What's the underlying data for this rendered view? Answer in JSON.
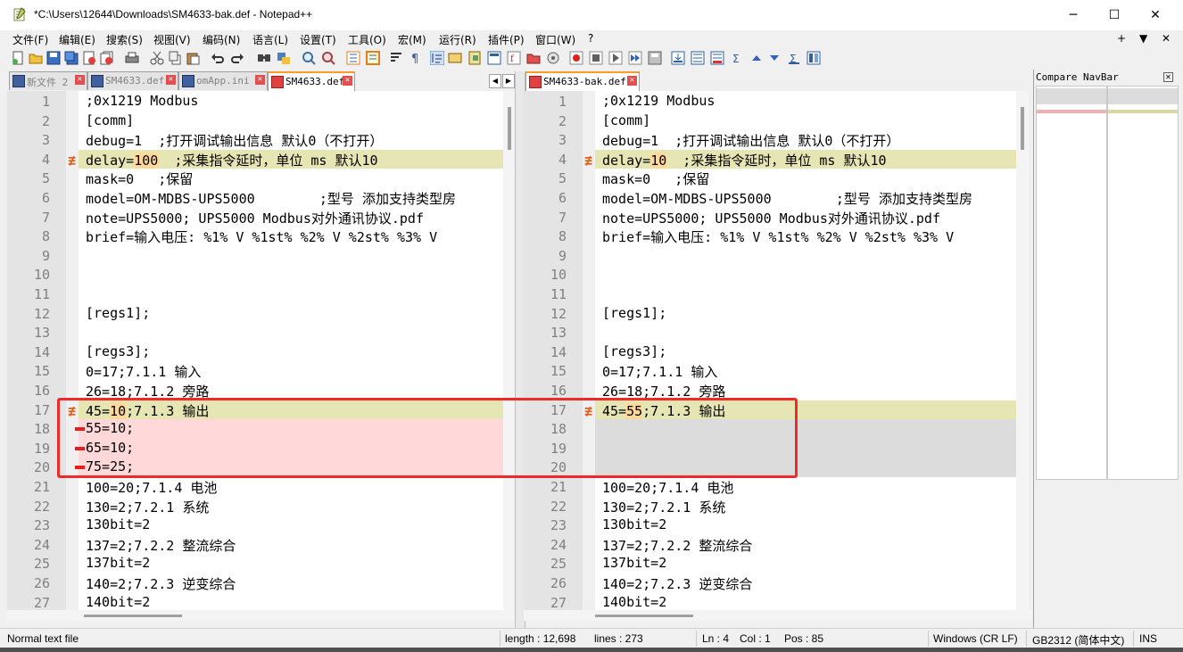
{
  "window": {
    "title": "*C:\\Users\\12644\\Downloads\\SM4633-bak.def - Notepad++",
    "minimize_glyph": "─",
    "maximize_glyph": "☐",
    "close_glyph": "✕"
  },
  "menu": {
    "items": [
      "文件(F)",
      "编辑(E)",
      "搜索(S)",
      "视图(V)",
      "编码(N)",
      "语言(L)",
      "设置(T)",
      "工具(O)",
      "宏(M)",
      "运行(R)",
      "插件(P)",
      "窗口(W)",
      "?"
    ],
    "right": [
      "+",
      "▼",
      "✕"
    ]
  },
  "left_tabs": [
    {
      "label": "新文件 2"
    },
    {
      "label": "SM4633.def"
    },
    {
      "label": "omApp.ini"
    },
    {
      "label": "SM4633.def"
    }
  ],
  "right_tabs": [
    {
      "label": "SM4633-bak.def"
    }
  ],
  "tab_nav": {
    "prev": "◀",
    "next": "▶"
  },
  "left_pane": {
    "lines": [
      {
        "n": "1",
        "text": ";0x1219 Modbus",
        "state": ""
      },
      {
        "n": "2",
        "text": "[comm]",
        "state": ""
      },
      {
        "n": "3",
        "text": "debug=1  ;打开调试输出信息 默认0（不打开）",
        "state": ""
      },
      {
        "n": "4",
        "pre": "delay=",
        "hl": "100",
        "post": "  ;采集指令延时，单位 ms 默认10",
        "state": "changed"
      },
      {
        "n": "5",
        "text": "mask=0   ;保留",
        "state": ""
      },
      {
        "n": "6",
        "text": "model=OM-MDBS-UPS5000        ;型号 添加支持类型房",
        "state": ""
      },
      {
        "n": "7",
        "text": "note=UPS5000; UPS5000 Modbus对外通讯协议.pdf",
        "state": ""
      },
      {
        "n": "8",
        "text": "brief=输入电压: %1% V %1st% %2% V %2st% %3% V",
        "state": ""
      },
      {
        "n": "9",
        "text": "",
        "state": ""
      },
      {
        "n": "10",
        "text": "",
        "state": ""
      },
      {
        "n": "11",
        "text": "",
        "state": ""
      },
      {
        "n": "12",
        "text": "[regs1];",
        "state": ""
      },
      {
        "n": "13",
        "text": "",
        "state": ""
      },
      {
        "n": "14",
        "text": "[regs3];",
        "state": ""
      },
      {
        "n": "15",
        "text": "0=17;7.1.1 输入",
        "state": ""
      },
      {
        "n": "16",
        "text": "26=18;7.1.2 旁路",
        "state": ""
      },
      {
        "n": "17",
        "pre": "45=",
        "hl": "10",
        "post": ";7.1.3 输出",
        "state": "changed"
      },
      {
        "n": "18",
        "text": "55=10;",
        "state": "removed"
      },
      {
        "n": "19",
        "text": "65=10;",
        "state": "removed"
      },
      {
        "n": "20",
        "text": "75=25;",
        "state": "removed"
      },
      {
        "n": "21",
        "text": "100=20;7.1.4 电池",
        "state": ""
      },
      {
        "n": "22",
        "text": "130=2;7.2.1 系统",
        "state": ""
      },
      {
        "n": "23",
        "text": "130bit=2",
        "state": ""
      },
      {
        "n": "24",
        "text": "137=2;7.2.2 整流综合",
        "state": ""
      },
      {
        "n": "25",
        "text": "137bit=2",
        "state": ""
      },
      {
        "n": "26",
        "text": "140=2;7.2.3 逆变综合",
        "state": ""
      },
      {
        "n": "27",
        "text": "140bit=2",
        "state": ""
      }
    ]
  },
  "right_pane": {
    "lines": [
      {
        "n": "1",
        "text": ";0x1219 Modbus",
        "state": ""
      },
      {
        "n": "2",
        "text": "[comm]",
        "state": ""
      },
      {
        "n": "3",
        "text": "debug=1  ;打开调试输出信息 默认0（不打开）",
        "state": ""
      },
      {
        "n": "4",
        "pre": "delay=",
        "hl": "10",
        "post": "  ;采集指令延时，单位 ms 默认10",
        "state": "changed"
      },
      {
        "n": "5",
        "text": "mask=0   ;保留",
        "state": ""
      },
      {
        "n": "6",
        "text": "model=OM-MDBS-UPS5000        ;型号 添加支持类型房",
        "state": ""
      },
      {
        "n": "7",
        "text": "note=UPS5000; UPS5000 Modbus对外通讯协议.pdf",
        "state": ""
      },
      {
        "n": "8",
        "text": "brief=输入电压: %1% V %1st% %2% V %2st% %3% V",
        "state": ""
      },
      {
        "n": "9",
        "text": "",
        "state": ""
      },
      {
        "n": "10",
        "text": "",
        "state": ""
      },
      {
        "n": "11",
        "text": "",
        "state": ""
      },
      {
        "n": "12",
        "text": "[regs1];",
        "state": ""
      },
      {
        "n": "13",
        "text": "",
        "state": ""
      },
      {
        "n": "14",
        "text": "[regs3];",
        "state": ""
      },
      {
        "n": "15",
        "text": "0=17;7.1.1 输入",
        "state": ""
      },
      {
        "n": "16",
        "text": "26=18;7.1.2 旁路",
        "state": ""
      },
      {
        "n": "17",
        "pre": "45=",
        "hl": "55",
        "post": ";7.1.3 输出",
        "state": "changed"
      },
      {
        "n": "18",
        "text": "",
        "state": "blank"
      },
      {
        "n": "19",
        "text": "",
        "state": "blank"
      },
      {
        "n": "20",
        "text": "",
        "state": "blank"
      },
      {
        "n": "21",
        "text": "100=20;7.1.4 电池",
        "state": ""
      },
      {
        "n": "22",
        "text": "130=2;7.2.1 系统",
        "state": ""
      },
      {
        "n": "23",
        "text": "130bit=2",
        "state": ""
      },
      {
        "n": "24",
        "text": "137=2;7.2.2 整流综合",
        "state": ""
      },
      {
        "n": "25",
        "text": "137bit=2",
        "state": ""
      },
      {
        "n": "26",
        "text": "140=2;7.2.3 逆变综合",
        "state": ""
      },
      {
        "n": "27",
        "text": "140bit=2",
        "state": ""
      }
    ]
  },
  "compare_navbar": {
    "title": "Compare NavBar",
    "close_glyph": "✕"
  },
  "status": {
    "file_type": "Normal text file",
    "length": "length : 12,698",
    "lines": "lines : 273",
    "ln": "Ln : 4",
    "col": "Col : 1",
    "pos": "Pos : 85",
    "eol": "Windows (CR LF)",
    "encoding": "GB2312 (简体中文)",
    "mode": "INS"
  },
  "colors": {
    "changed_bg": "#e6e6b4",
    "removed_bg": "#ffd9d9",
    "blank_bg": "#dcdcdc",
    "highlight": "#ffd89a",
    "annotation_box": "#ee2b2b"
  }
}
